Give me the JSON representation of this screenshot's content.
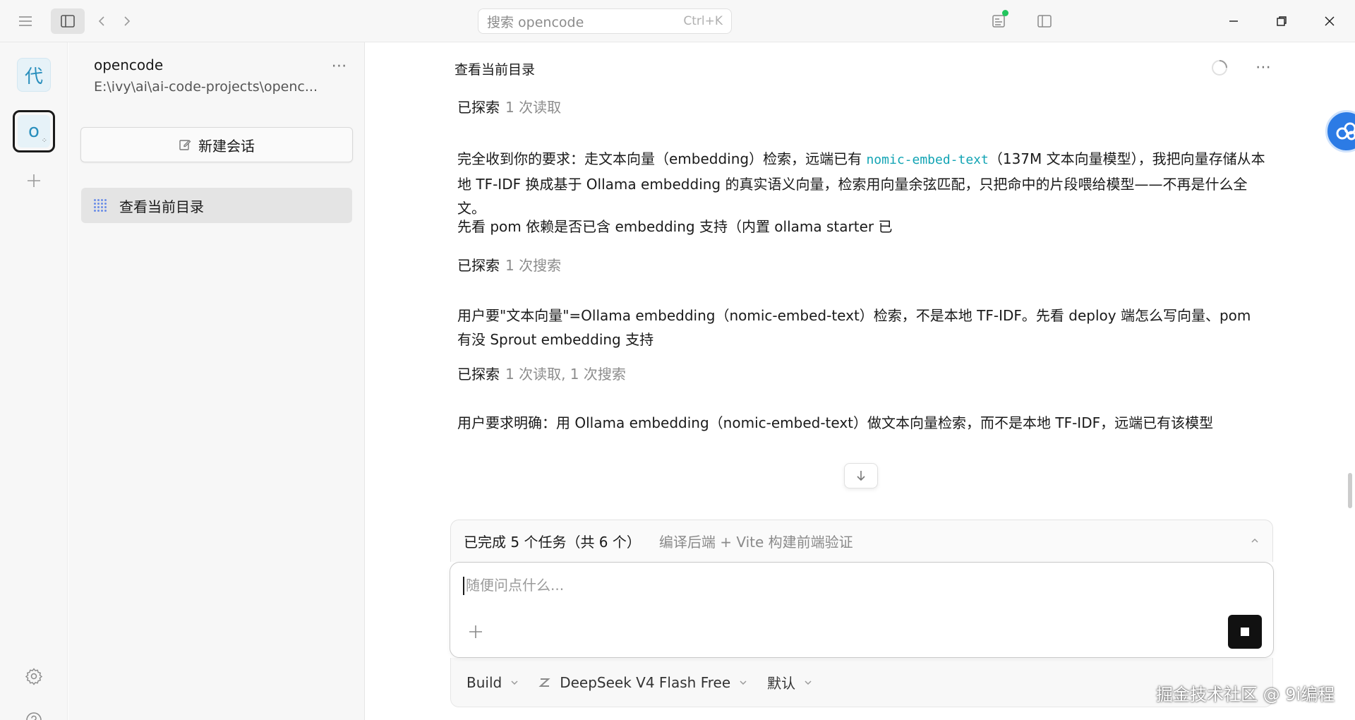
{
  "titlebar": {
    "search_placeholder": "搜索 opencode",
    "search_shortcut": "Ctrl+K",
    "status_color": "#22c55e"
  },
  "rail": {
    "project_1_initial": "代",
    "project_2_initial": "o",
    "project_2_sub": "⁘"
  },
  "sidebar": {
    "project_name": "opencode",
    "project_path": "E:\\ivy\\ai\\ai-code-projects\\openc...",
    "more": "⋯",
    "new_session_label": "新建会话",
    "sessions": [
      {
        "title": "查看当前目录"
      }
    ]
  },
  "main": {
    "title": "查看当前目录",
    "more": "⋯",
    "accent_color": "#12a4b4",
    "messages": [
      {
        "explored": "已探索",
        "detail": "1 次读取"
      },
      {
        "text_before": "完全收到你的要求：走文本向量（embedding）检索，远端已有 ",
        "code": "nomic-embed-text",
        "text_after": "（137M 文本向量模型），我把向量存储从本地 TF-IDF 换成基于 Ollama embedding 的真实语义向量，检索用向量余弦匹配，只把命中的片段喂给模型——不再是什么全文。"
      },
      {
        "text": "先看 pom 依赖是否已含 embedding 支持（内置 ollama starter 已"
      },
      {
        "explored": "已探索",
        "detail": "1 次搜索"
      },
      {
        "text": "用户要\"文本向量\"=Ollama embedding（nomic-embed-text）检索，不是本地 TF-IDF。先看 deploy 端怎么写向量、pom 有没 Sprout embedding 支持"
      },
      {
        "explored": "已探索",
        "detail": "1 次读取, 1 次搜索"
      },
      {
        "text": "用户要求明确：用 Ollama embedding（nomic-embed-text）做文本向量检索，而不是本地 TF-IDF，远端已有该模型"
      }
    ]
  },
  "composer": {
    "tasks_done": "已完成 5 个任务（共 6 个）",
    "tasks_current": "编译后端 + Vite 构建前端验证",
    "placeholder": "随便问点什么...",
    "mode": "Build",
    "model": "DeepSeek V4 Flash Free",
    "variant": "默认"
  },
  "watermark": "掘金技术社区 @ 9i编程"
}
